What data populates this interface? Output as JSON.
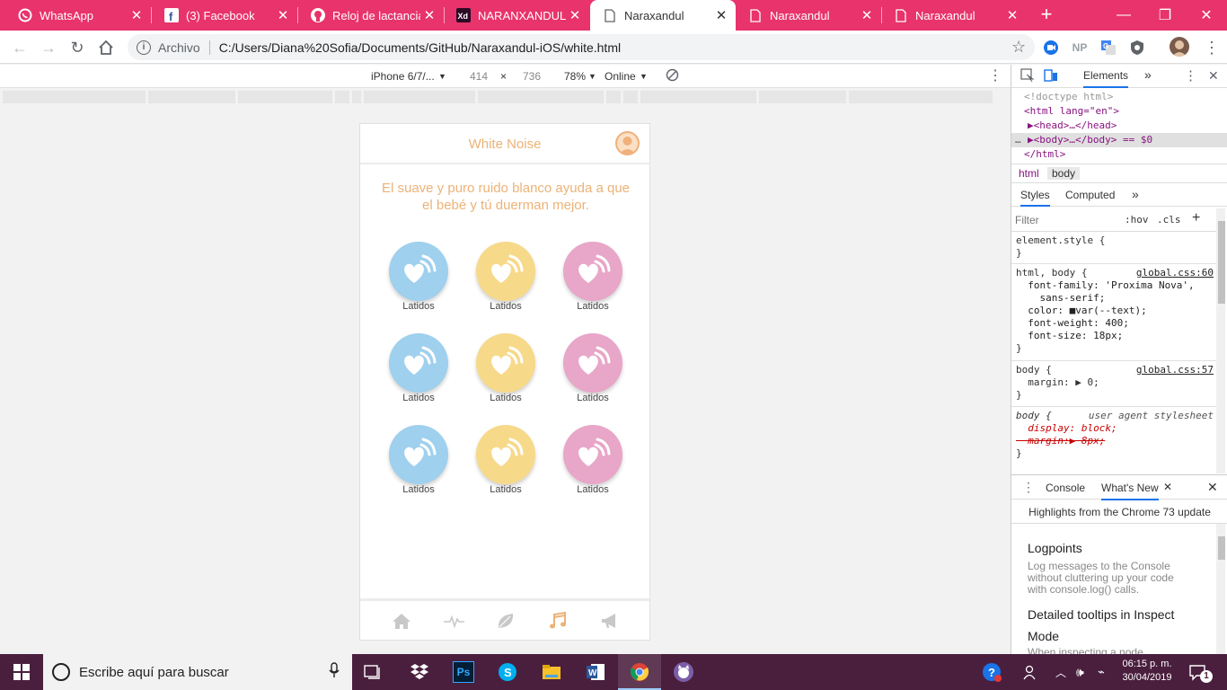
{
  "browser": {
    "tabs": [
      {
        "title": "WhatsApp",
        "icon": "whatsapp-icon"
      },
      {
        "title": "(3) Facebook",
        "icon": "facebook-icon"
      },
      {
        "title": "Reloj de lactancia ·",
        "icon": "github-icon"
      },
      {
        "title": "NARANXANDUL",
        "icon": "xd-icon"
      },
      {
        "title": "Naraxandul",
        "icon": "page-icon"
      },
      {
        "title": "Naraxandul",
        "icon": "page-icon"
      },
      {
        "title": "Naraxandul",
        "icon": "page-icon"
      }
    ],
    "scheme": "Archivo",
    "url": "C:/Users/Diana%20Sofia/Documents/GitHub/Naraxandul-iOS/white.html",
    "extensions": [
      "NP"
    ]
  },
  "device_toolbar": {
    "device": "iPhone 6/7/...",
    "width": "414",
    "times": "×",
    "height": "736",
    "zoom": "78%",
    "network": "Online"
  },
  "app": {
    "title": "White Noise",
    "description": "El suave y puro ruido blanco ayuda a que el bebé y tú duerman mejor.",
    "sounds": [
      {
        "label": "Latidos",
        "color": "#9fd0ee"
      },
      {
        "label": "Latidos",
        "color": "#f7d98a"
      },
      {
        "label": "Latidos",
        "color": "#e8a6c8"
      },
      {
        "label": "Latidos",
        "color": "#9fd0ee"
      },
      {
        "label": "Latidos",
        "color": "#f7d98a"
      },
      {
        "label": "Latidos",
        "color": "#e8a6c8"
      },
      {
        "label": "Latidos",
        "color": "#9fd0ee"
      },
      {
        "label": "Latidos",
        "color": "#f7d98a"
      },
      {
        "label": "Latidos",
        "color": "#e8a6c8"
      }
    ],
    "nav": [
      "home-icon",
      "heartbeat-icon",
      "leaf-icon",
      "music-icon",
      "megaphone-icon"
    ],
    "accent": "#ecb277"
  },
  "devtools": {
    "main_tab": "Elements",
    "dom": [
      "<!doctype html>",
      "<html lang=\"en\">",
      "▶<head>…</head>",
      "▶<body>…</body> == $0",
      "</html>"
    ],
    "crumbs": [
      "html",
      "body"
    ],
    "subtabs": [
      "Styles",
      "Computed"
    ],
    "filter_placeholder": "Filter",
    "hov": ":hov",
    "cls": ".cls",
    "rules": [
      {
        "selector": "element.style {",
        "source": "",
        "lines": [
          "}"
        ]
      },
      {
        "selector": "html, body {",
        "source": "global.css:60",
        "lines": [
          "  font-family: 'Proxima Nova',",
          "    sans-serif;",
          "  color: ■var(--text);",
          "  font-weight: 400;",
          "  font-size: 18px;",
          "}"
        ]
      },
      {
        "selector": "body {",
        "source": "global.css:57",
        "lines": [
          "  margin: ▶ 0;",
          "}"
        ]
      },
      {
        "selector": "body {",
        "source": "user agent stylesheet",
        "lines": [
          "  display: block;",
          "  margin:▶ 8px;",
          "}"
        ]
      }
    ],
    "drawer_tabs": [
      "Console",
      "What's New"
    ],
    "highlights": "Highlights from the Chrome 73 update",
    "whatsnew": [
      {
        "title": "Logpoints",
        "body": "Log messages to the Console without cluttering up your code with console.log() calls."
      },
      {
        "title": "Detailed tooltips in Inspect Mode",
        "body": "When inspecting a node"
      }
    ]
  },
  "taskbar": {
    "search_placeholder": "Escribe aquí para buscar",
    "time": "06:15 p. m.",
    "date": "30/04/2019",
    "notifications": "1"
  }
}
